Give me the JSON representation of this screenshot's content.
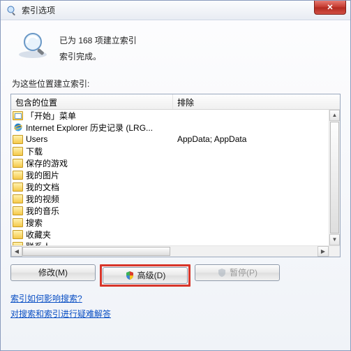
{
  "titlebar": {
    "title": "索引选项"
  },
  "summary": {
    "line1": "已为 168 项建立索引",
    "line2": "索引完成。"
  },
  "section_label": "为这些位置建立索引:",
  "list": {
    "headers": {
      "col1": "包含的位置",
      "col2": "排除"
    },
    "rows": [
      {
        "icon": "folder-menu",
        "name": "「开始」菜单",
        "exclude": ""
      },
      {
        "icon": "ie",
        "name": "Internet Explorer 历史记录 (LRG...",
        "exclude": ""
      },
      {
        "icon": "folder",
        "name": "Users",
        "exclude": "AppData; AppData"
      },
      {
        "icon": "folder",
        "name": "下载",
        "exclude": ""
      },
      {
        "icon": "folder",
        "name": "保存的游戏",
        "exclude": ""
      },
      {
        "icon": "folder",
        "name": "我的图片",
        "exclude": ""
      },
      {
        "icon": "folder",
        "name": "我的文档",
        "exclude": ""
      },
      {
        "icon": "folder",
        "name": "我的视频",
        "exclude": ""
      },
      {
        "icon": "folder",
        "name": "我的音乐",
        "exclude": ""
      },
      {
        "icon": "folder",
        "name": "搜索",
        "exclude": ""
      },
      {
        "icon": "folder",
        "name": "收藏夹",
        "exclude": ""
      },
      {
        "icon": "folder",
        "name": "联系人",
        "exclude": ""
      }
    ]
  },
  "buttons": {
    "modify": "修改(M)",
    "advanced": "高级(D)",
    "pause": "暂停(P)"
  },
  "links": {
    "link1": "索引如何影响搜索?",
    "link2": "对搜索和索引进行疑难解答"
  }
}
